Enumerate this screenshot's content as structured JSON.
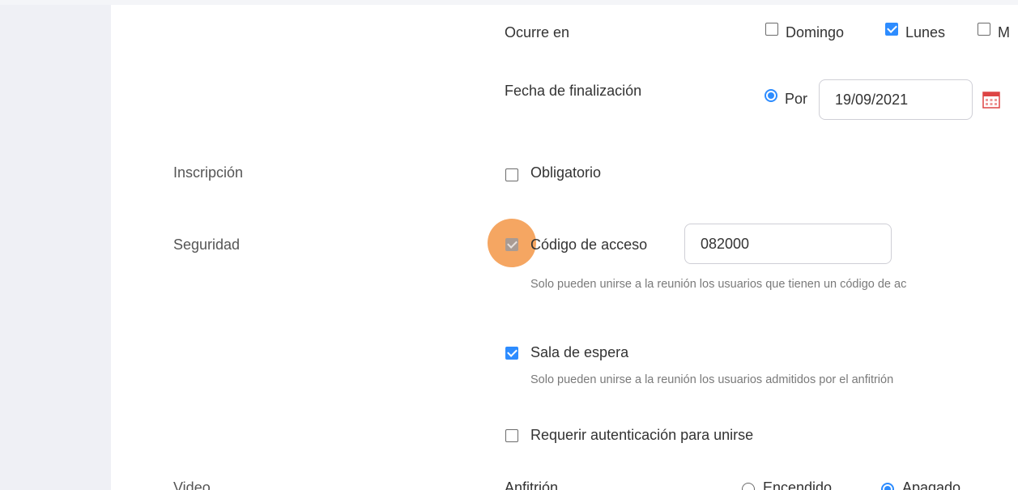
{
  "recurrence": {
    "occurs_label": "Ocurre en",
    "days": [
      {
        "label": "Domingo",
        "checked": false
      },
      {
        "label": "Lunes",
        "checked": true
      },
      {
        "label": "M",
        "checked": false
      }
    ],
    "end_label": "Fecha de finalización",
    "by_label": "Por",
    "end_date": "19/09/2021"
  },
  "registration": {
    "label": "Inscripción",
    "required_label": "Obligatorio",
    "required_checked": false
  },
  "security": {
    "label": "Seguridad",
    "passcode_label": "Código de acceso",
    "passcode_checked": true,
    "passcode_value": "082000",
    "passcode_desc": "Solo pueden unirse a la reunión los usuarios que tienen un código de ac",
    "waiting_label": "Sala de espera",
    "waiting_checked": true,
    "waiting_desc": "Solo pueden unirse a la reunión los usuarios admitidos por el anfitrión",
    "auth_label": "Requerir autenticación para unirse",
    "auth_checked": false
  },
  "video": {
    "label": "Video",
    "host_label": "Anfitrión",
    "on_label": "Encendido",
    "off_label": "Apagado",
    "selected": "Apagado"
  },
  "colors": {
    "accent": "#2d8cff",
    "highlight": "#f4a15a",
    "background": "#eff0f5"
  },
  "icons": {
    "calendar": "calendar-icon"
  }
}
